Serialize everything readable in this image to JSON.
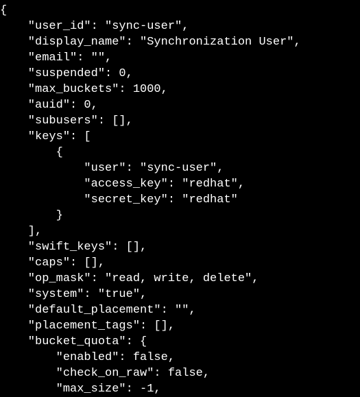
{
  "terminal": {
    "background": "#000000",
    "foreground": "#ffffff",
    "lines": [
      "{",
      "    \"user_id\": \"sync-user\",",
      "    \"display_name\": \"Synchronization User\",",
      "    \"email\": \"\",",
      "    \"suspended\": 0,",
      "    \"max_buckets\": 1000,",
      "    \"auid\": 0,",
      "    \"subusers\": [],",
      "    \"keys\": [",
      "        {",
      "            \"user\": \"sync-user\",",
      "            \"access_key\": \"redhat\",",
      "            \"secret_key\": \"redhat\"",
      "        }",
      "    ],",
      "    \"swift_keys\": [],",
      "    \"caps\": [],",
      "    \"op_mask\": \"read, write, delete\",",
      "    \"system\": \"true\",",
      "    \"default_placement\": \"\",",
      "    \"placement_tags\": [],",
      "    \"bucket_quota\": {",
      "        \"enabled\": false,",
      "        \"check_on_raw\": false,",
      "        \"max_size\": -1,"
    ]
  }
}
